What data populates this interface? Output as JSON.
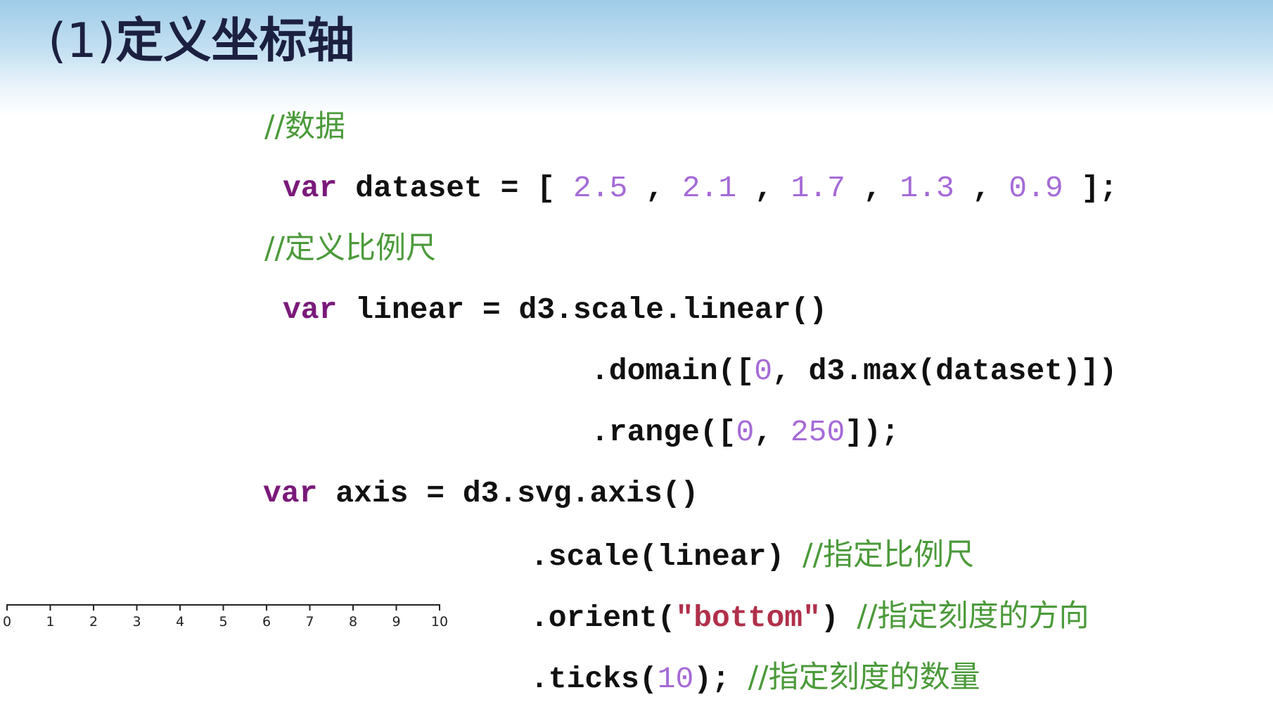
{
  "slide": {
    "title_num": "(1)",
    "title_text": "定义坐标轴"
  },
  "code": {
    "c1": "//数据",
    "l2": {
      "kw": "var",
      "pre": " dataset = [ ",
      "v1": "2.5",
      "s1": " , ",
      "v2": "2.1",
      "s2": " , ",
      "v3": "1.7",
      "s3": " , ",
      "v4": "1.3",
      "s4": " , ",
      "v5": "0.9",
      "post": " ];"
    },
    "c3": "//定义比例尺",
    "l4": {
      "kw": "var",
      "rest": " linear = d3.scale.linear()"
    },
    "l5": {
      "pre": ".domain([",
      "n": "0",
      "post": ", d3.max(dataset)])"
    },
    "l6": {
      "pre": ".range([",
      "n1": "0",
      "mid": ", ",
      "n2": "250",
      "post": "]);"
    },
    "l7": {
      "kw": "var",
      "rest": " axis = d3.svg.axis()"
    },
    "l8": {
      "code": ".scale(linear) ",
      "comment": "//指定比例尺"
    },
    "l9": {
      "pre": ".orient(",
      "str": "\"bottom\"",
      "post": ") ",
      "comment": "//指定刻度的方向"
    },
    "l10": {
      "pre": ".ticks(",
      "n": "10",
      "post": "); ",
      "comment": "//指定刻度的数量"
    }
  },
  "axis_figure": {
    "tick_labels": [
      "0",
      "1",
      "2",
      "3",
      "4",
      "5",
      "6",
      "7",
      "8",
      "9",
      "10"
    ]
  }
}
